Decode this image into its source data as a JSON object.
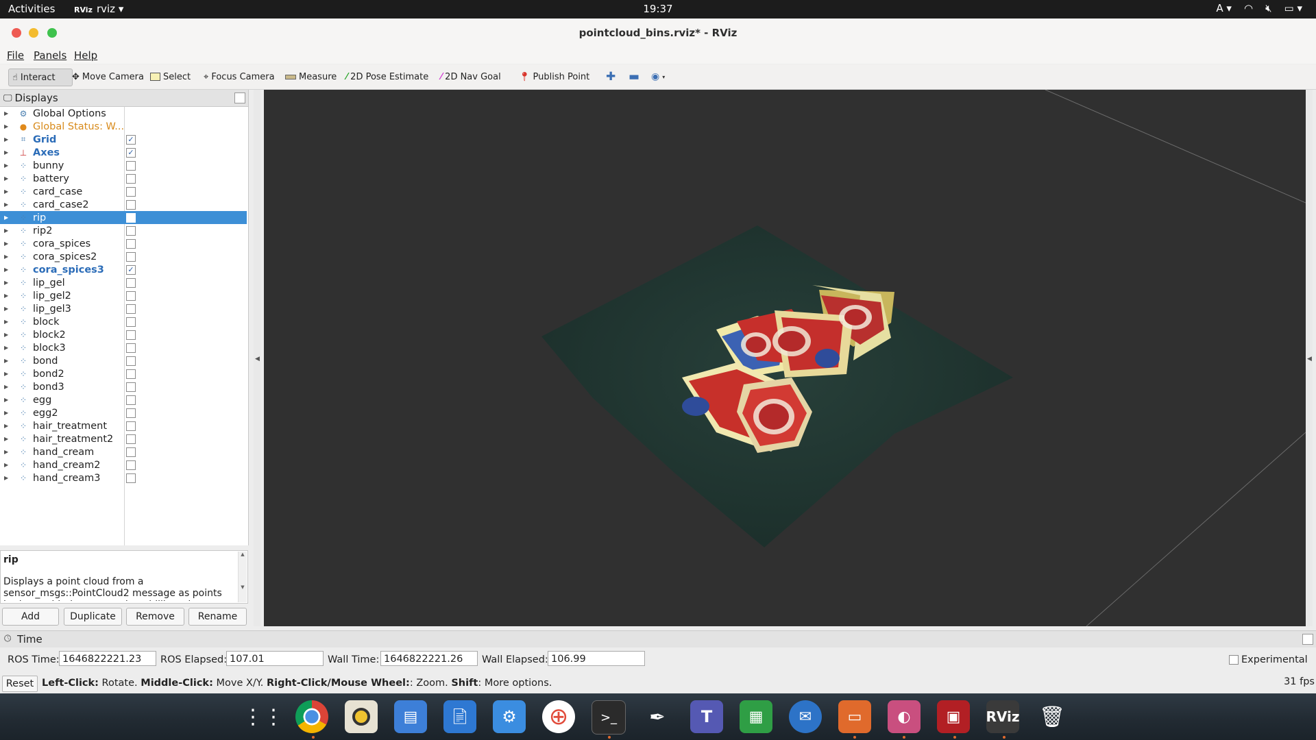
{
  "topbar": {
    "activities": "Activities",
    "app_name": "rviz",
    "app_icon_text": "RViz",
    "clock": "19:37",
    "input_method": "A"
  },
  "window": {
    "title": "pointcloud_bins.rviz* - RViz"
  },
  "menu": [
    "File",
    "Panels",
    "Help"
  ],
  "toolbar": {
    "tools": [
      {
        "label": "Interact",
        "icon": "cursor-icon"
      },
      {
        "label": "Move Camera",
        "icon": "move-icon"
      },
      {
        "label": "Select",
        "icon": "select-box-icon"
      },
      {
        "label": "Focus Camera",
        "icon": "crosshair-icon"
      },
      {
        "label": "Measure",
        "icon": "ruler-icon"
      },
      {
        "label": "2D Pose Estimate",
        "icon": "green-arrow-icon"
      },
      {
        "label": "2D Nav Goal",
        "icon": "pink-arrow-icon"
      },
      {
        "label": "Publish Point",
        "icon": "map-pin-icon"
      }
    ]
  },
  "displays": {
    "title": "Displays",
    "items": [
      {
        "label": "Global Options",
        "checked": null
      },
      {
        "label": "Global Status: W...",
        "checked": null
      },
      {
        "label": "Grid",
        "checked": "✓"
      },
      {
        "label": "Axes",
        "checked": "✓"
      },
      {
        "label": "bunny",
        "checked": ""
      },
      {
        "label": "battery",
        "checked": ""
      },
      {
        "label": "card_case",
        "checked": ""
      },
      {
        "label": "card_case2",
        "checked": ""
      },
      {
        "label": "rip",
        "checked": ""
      },
      {
        "label": "rip2",
        "checked": ""
      },
      {
        "label": "cora_spices",
        "checked": ""
      },
      {
        "label": "cora_spices2",
        "checked": ""
      },
      {
        "label": "cora_spices3",
        "checked": "✓"
      },
      {
        "label": "lip_gel",
        "checked": ""
      },
      {
        "label": "lip_gel2",
        "checked": ""
      },
      {
        "label": "lip_gel3",
        "checked": ""
      },
      {
        "label": "block",
        "checked": ""
      },
      {
        "label": "block2",
        "checked": ""
      },
      {
        "label": "block3",
        "checked": ""
      },
      {
        "label": "bond",
        "checked": ""
      },
      {
        "label": "bond2",
        "checked": ""
      },
      {
        "label": "bond3",
        "checked": ""
      },
      {
        "label": "egg",
        "checked": ""
      },
      {
        "label": "egg2",
        "checked": ""
      },
      {
        "label": "hair_treatment",
        "checked": ""
      },
      {
        "label": "hair_treatment2",
        "checked": ""
      },
      {
        "label": "hand_cream",
        "checked": ""
      },
      {
        "label": "hand_cream2",
        "checked": ""
      },
      {
        "label": "hand_cream3",
        "checked": ""
      }
    ],
    "selected": "rip",
    "description_title": "rip",
    "description_text": "Displays a point cloud from a sensor_msgs::PointCloud2 message as points in the world, drawn as points, billboards, or cubes.",
    "buttons": [
      "Add",
      "Duplicate",
      "Remove",
      "Rename"
    ]
  },
  "time": {
    "title": "Time",
    "ros_time_label": "ROS Time:",
    "ros_time": "1646822221.23",
    "ros_elapsed_label": "ROS Elapsed:",
    "ros_elapsed": "107.01",
    "wall_time_label": "Wall Time:",
    "wall_time": "1646822221.26",
    "wall_elapsed_label": "Wall Elapsed:",
    "wall_elapsed": "106.99",
    "experimental_label": "Experimental"
  },
  "status": {
    "reset": "Reset",
    "hint_parts": [
      {
        "b": "Left-Click:",
        "t": " Rotate. "
      },
      {
        "b": "Middle-Click:",
        "t": " Move X/Y. "
      },
      {
        "b": "Right-Click/Mouse Wheel:",
        "t": ": Zoom. "
      },
      {
        "b": "Shift",
        "t": ": More options."
      }
    ],
    "fps": "31 fps"
  },
  "dock": {
    "apps": [
      "app-grid-icon",
      "chrome-icon",
      "rhythmbox-icon",
      "files-icon",
      "writer-icon",
      "settings-icon",
      "help-icon",
      "terminal-icon",
      "inkscape-icon",
      "teams-icon",
      "calc-icon",
      "thunderbird-icon",
      "impress-icon",
      "image-viewer-icon",
      "rqt-icon",
      "rviz-icon",
      "trash-icon"
    ]
  },
  "colors": {
    "selection": "#3d8fd6",
    "viewport_bg": "#303030",
    "cloth": "#1f3530"
  }
}
